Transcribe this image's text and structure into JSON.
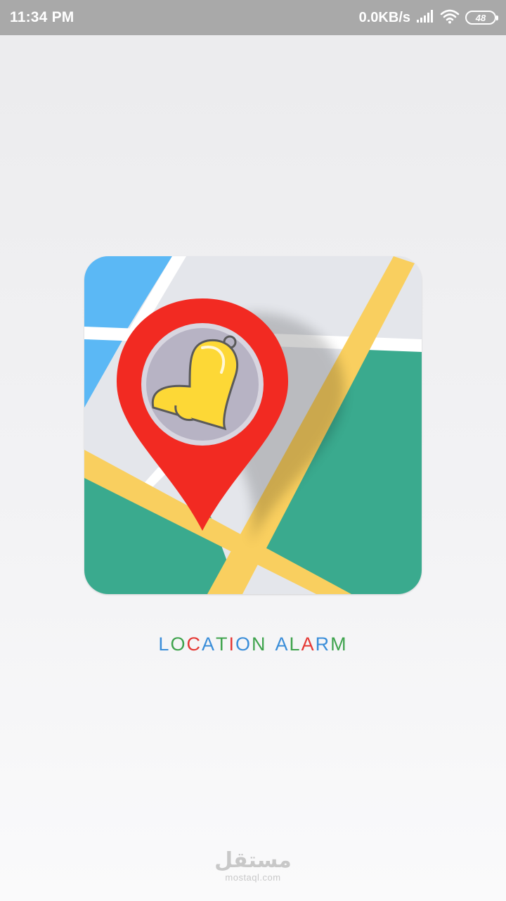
{
  "status_bar": {
    "time": "11:34 PM",
    "net_speed": "0.0KB/s",
    "battery": "48",
    "icons": [
      "signal-icon",
      "wifi-icon",
      "battery-icon"
    ]
  },
  "app": {
    "name_letters": [
      {
        "char": "L",
        "color": "#3b8ed9"
      },
      {
        "char": "O",
        "color": "#3fa34d"
      },
      {
        "char": "C",
        "color": "#e53935"
      },
      {
        "char": "A",
        "color": "#3b8ed9"
      },
      {
        "char": "T",
        "color": "#3fa34d"
      },
      {
        "char": "I",
        "color": "#e53935"
      },
      {
        "char": "O",
        "color": "#3b8ed9"
      },
      {
        "char": "N",
        "color": "#3fa34d"
      },
      {
        "char": " ",
        "color": "#3b8ed9"
      },
      {
        "char": "A",
        "color": "#3b8ed9"
      },
      {
        "char": "L",
        "color": "#3fa34d"
      },
      {
        "char": "A",
        "color": "#e53935"
      },
      {
        "char": "R",
        "color": "#3b8ed9"
      },
      {
        "char": "M",
        "color": "#3fa34d"
      }
    ],
    "icon": "map-pin-bell-icon"
  },
  "watermark": {
    "logo": "مستقل",
    "url": "mostaql.com"
  },
  "colors": {
    "status_bar": "#a9a9a9",
    "map_water": "#5bb8f5",
    "map_green": "#3aaa8e",
    "map_road": "#f9cf5f",
    "pin_red": "#f22a22",
    "bell_yellow": "#fdd836"
  }
}
